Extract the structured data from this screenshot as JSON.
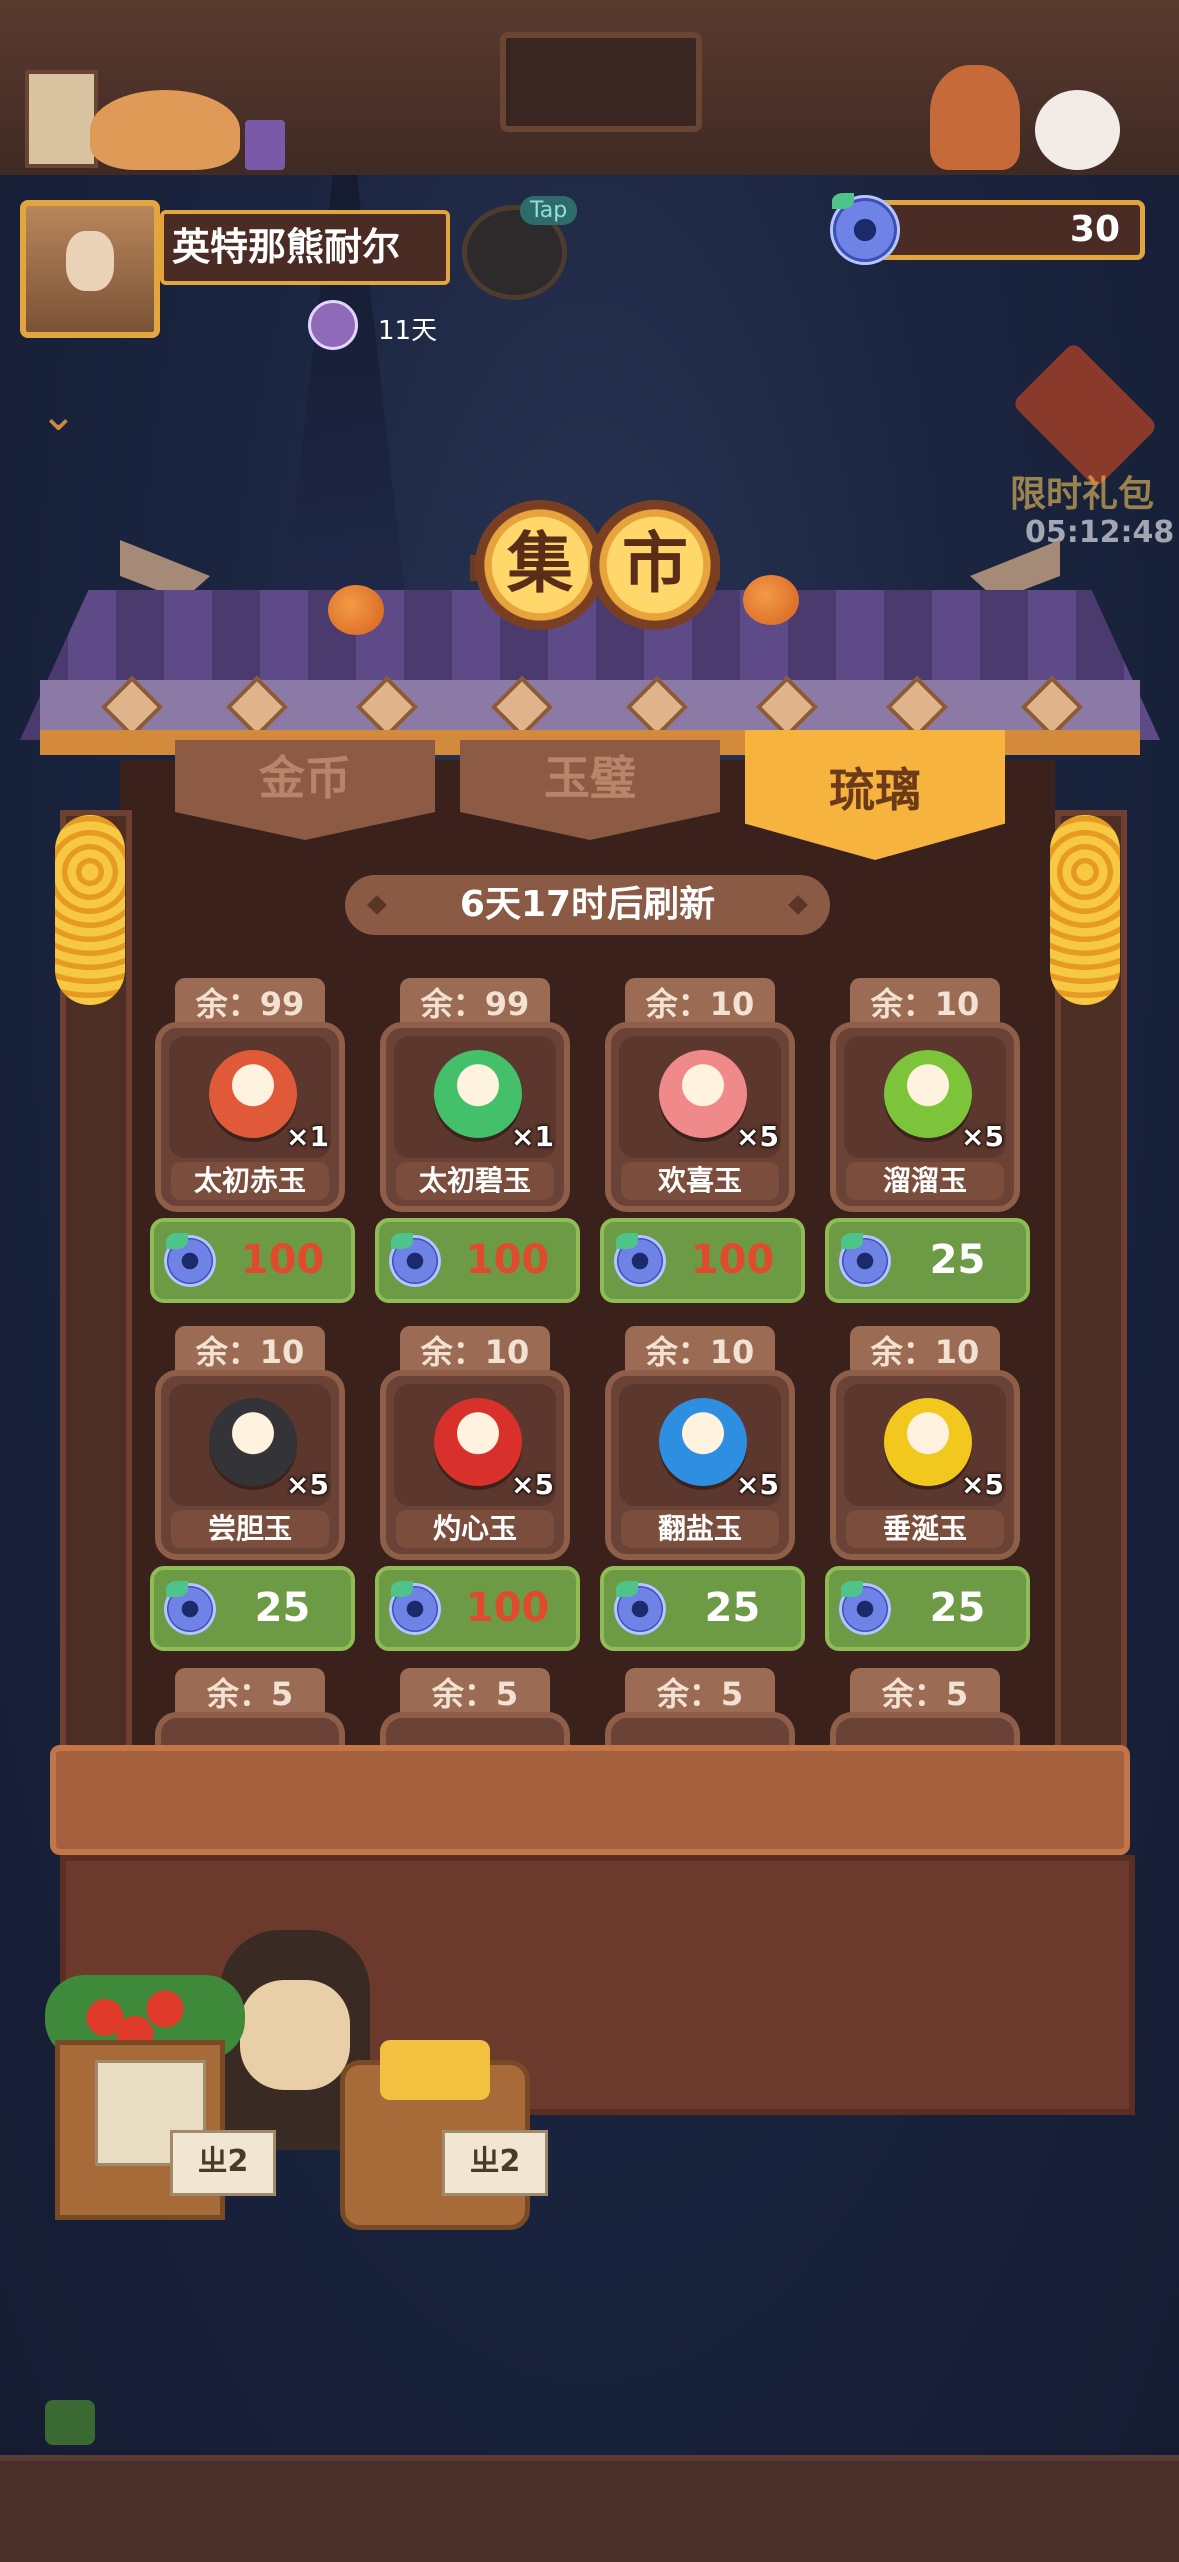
{
  "player": {
    "name": "英特那熊耐尔",
    "days": "11天"
  },
  "tap": {
    "label": "Tap"
  },
  "currency": {
    "amount": "30"
  },
  "gift": {
    "title": "限时礼包",
    "timer": "05:12:48"
  },
  "sign": {
    "char1": "集",
    "char2": "市"
  },
  "tabs": [
    {
      "label": "金币",
      "active": false
    },
    {
      "label": "玉璧",
      "active": false
    },
    {
      "label": "琉璃",
      "active": true
    }
  ],
  "refresh_text": "6天17时后刷新",
  "items": [
    {
      "remain": "余：99",
      "name": "太初赤玉",
      "qty": "×1",
      "price": "100",
      "price_color": "red",
      "color": "#e05a3a",
      "icon": "jade-stone-red-icon"
    },
    {
      "remain": "余：99",
      "name": "太初碧玉",
      "qty": "×1",
      "price": "100",
      "price_color": "red",
      "color": "#44c06a",
      "icon": "jade-stone-green-icon"
    },
    {
      "remain": "余：10",
      "name": "欢喜玉",
      "qty": "×5",
      "price": "100",
      "price_color": "red",
      "color": "#f08a8a",
      "icon": "jade-pink-icon"
    },
    {
      "remain": "余：10",
      "name": "溜溜玉",
      "qty": "×5",
      "price": "25",
      "price_color": "white",
      "color": "#7cc43a",
      "icon": "jade-green-icon"
    },
    {
      "remain": "余：10",
      "name": "尝胆玉",
      "qty": "×5",
      "price": "25",
      "price_color": "white",
      "color": "#333338",
      "icon": "jade-black-icon"
    },
    {
      "remain": "余：10",
      "name": "灼心玉",
      "qty": "×5",
      "price": "100",
      "price_color": "red",
      "color": "#d8302a",
      "icon": "jade-red-icon"
    },
    {
      "remain": "余：10",
      "name": "翻盐玉",
      "qty": "×5",
      "price": "25",
      "price_color": "white",
      "color": "#2e8ee0",
      "icon": "jade-blue-icon"
    },
    {
      "remain": "余：10",
      "name": "垂涎玉",
      "qty": "×5",
      "price": "25",
      "price_color": "white",
      "color": "#f2c81e",
      "icon": "jade-yellow-icon"
    }
  ],
  "row3_remain": [
    "余：5",
    "余：5",
    "余：5",
    "余：5"
  ],
  "stall_tags": [
    "ㄓ2",
    "ㄓ2"
  ],
  "colors": {
    "accent": "#f6b33e",
    "price_green": "#6d9a44",
    "price_red": "#e04a2d"
  }
}
